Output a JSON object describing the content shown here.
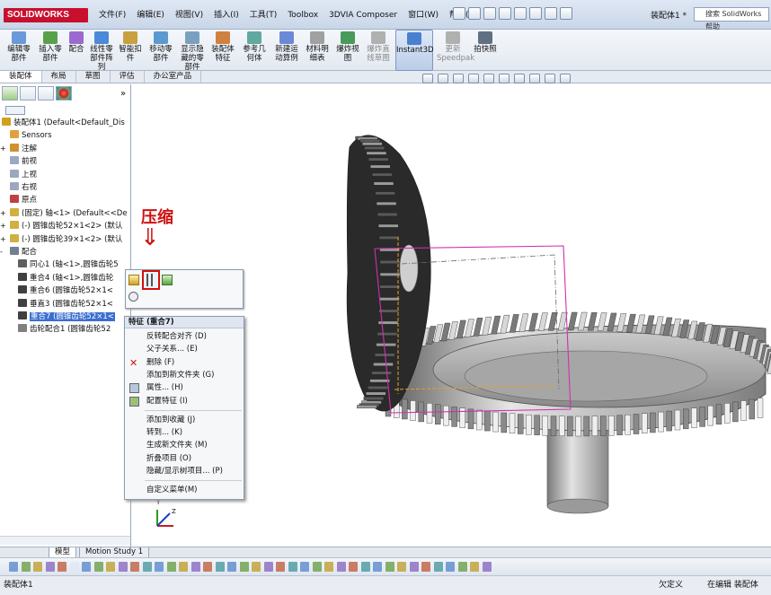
{
  "app": {
    "logo": "SOLIDWORKS",
    "doc_title": "装配体1 *",
    "search_placeholder": "搜索 SolidWorks 帮助"
  },
  "menu": [
    "文件(F)",
    "编辑(E)",
    "视图(V)",
    "插入(I)",
    "工具(T)",
    "Toolbox",
    "3DVIA Composer",
    "窗口(W)",
    "帮助(H)"
  ],
  "ribbon": [
    {
      "label": "编辑零\n部件",
      "icon": "edit-component-icon",
      "enabled": true
    },
    {
      "label": "插入零\n部件",
      "icon": "insert-component-icon",
      "enabled": true
    },
    {
      "label": "配合",
      "icon": "mate-icon",
      "enabled": true
    },
    {
      "label": "线性零\n部件阵\n列",
      "icon": "linear-pattern-icon",
      "enabled": true
    },
    {
      "label": "智能扣\n件",
      "icon": "smart-fastener-icon",
      "enabled": true
    },
    {
      "label": "移动零\n部件",
      "icon": "move-component-icon",
      "enabled": true
    },
    {
      "label": "显示隐\n藏的零\n部件",
      "icon": "show-hidden-icon",
      "enabled": true
    },
    {
      "label": "装配体\n特征",
      "icon": "assembly-feature-icon",
      "enabled": true
    },
    {
      "label": "参考几\n何体",
      "icon": "reference-geometry-icon",
      "enabled": true
    },
    {
      "label": "新建运\n动算例",
      "icon": "new-motion-study-icon",
      "enabled": true
    },
    {
      "label": "材料明\n细表",
      "icon": "bom-icon",
      "enabled": true
    },
    {
      "label": "爆炸视\n图",
      "icon": "exploded-view-icon",
      "enabled": true
    },
    {
      "label": "爆炸直\n线草图",
      "icon": "explode-line-icon",
      "enabled": false
    },
    {
      "label": "Instant3D",
      "icon": "instant3d-icon",
      "enabled": true
    },
    {
      "label": "更新\nSpeedpak",
      "icon": "speedpak-icon",
      "enabled": false
    },
    {
      "label": "拍快照",
      "icon": "snapshot-icon",
      "enabled": true
    }
  ],
  "cmd_tabs": [
    "装配体",
    "布局",
    "草图",
    "评估",
    "办公室产品"
  ],
  "tree": [
    {
      "label": "装配体1  (Default<Default_Dis",
      "icon": "assembly-icon",
      "indent": 0,
      "expander": ""
    },
    {
      "label": "Sensors",
      "icon": "sensors-icon",
      "indent": 1,
      "expander": ""
    },
    {
      "label": "注解",
      "icon": "annotations-icon",
      "indent": 1,
      "expander": "+"
    },
    {
      "label": "前视",
      "icon": "plane-icon",
      "indent": 1,
      "expander": ""
    },
    {
      "label": "上视",
      "icon": "plane-icon",
      "indent": 1,
      "expander": ""
    },
    {
      "label": "右视",
      "icon": "plane-icon",
      "indent": 1,
      "expander": ""
    },
    {
      "label": "原点",
      "icon": "origin-icon",
      "indent": 1,
      "expander": ""
    },
    {
      "label": "(固定) 轴<1> (Default<<De",
      "icon": "part-icon",
      "indent": 1,
      "expander": "+"
    },
    {
      "label": "(-) 圆锥齿轮52×1<2> (默认",
      "icon": "part-icon",
      "indent": 1,
      "expander": "+"
    },
    {
      "label": "(-) 圆锥齿轮39×1<2> (默认",
      "icon": "part-icon",
      "indent": 1,
      "expander": "+"
    },
    {
      "label": "配合",
      "icon": "mates-icon",
      "indent": 1,
      "expander": "-"
    },
    {
      "label": "同心1 (轴<1>,圆锥齿轮5",
      "icon": "concentric-icon",
      "indent": 2,
      "expander": ""
    },
    {
      "label": "重合4 (轴<1>,圆锥齿轮",
      "icon": "coincident-icon",
      "indent": 2,
      "expander": ""
    },
    {
      "label": "重合6 (圆锥齿轮52×1<",
      "icon": "coincident-icon",
      "indent": 2,
      "expander": ""
    },
    {
      "label": "垂直3 (圆锥齿轮52×1<",
      "icon": "perpendicular-icon",
      "indent": 2,
      "expander": ""
    },
    {
      "label": "重合7 (圆锥齿轮52×1<",
      "icon": "coincident-icon",
      "indent": 2,
      "expander": "",
      "selected": true
    },
    {
      "label": "齿轮配合1 (圆锥齿轮52",
      "icon": "gear-mate-icon",
      "indent": 2,
      "expander": ""
    }
  ],
  "annotation": {
    "text": "压缩",
    "arrow": "⇓"
  },
  "context_menu": {
    "header": "特征 (重合7)",
    "groups": [
      [
        {
          "label": "反转配合对齐 (D)",
          "icon": ""
        },
        {
          "label": "父子关系... (E)",
          "icon": ""
        },
        {
          "label": "删除 (F)",
          "icon": "delete-icon"
        },
        {
          "label": "添加到新文件夹 (G)",
          "icon": ""
        },
        {
          "label": "属性... (H)",
          "icon": "properties-icon"
        },
        {
          "label": "配置特征 (I)",
          "icon": "configure-icon"
        }
      ],
      [
        {
          "label": "添加到收藏 (J)",
          "icon": ""
        },
        {
          "label": "转到... (K)",
          "icon": ""
        },
        {
          "label": "生成新文件夹 (M)",
          "icon": ""
        },
        {
          "label": "折叠项目 (O)",
          "icon": ""
        },
        {
          "label": "隐藏/显示树项目... (P)",
          "icon": ""
        }
      ],
      [
        {
          "label": "自定义菜单(M)",
          "icon": ""
        }
      ]
    ]
  },
  "bottom_tabs": [
    "模型",
    "Motion Study 1"
  ],
  "status": {
    "left": "装配体1",
    "right1": "欠定义",
    "right2": "在编辑 装配体"
  },
  "triad": {
    "x": "X",
    "y": "Y",
    "z": "Z"
  },
  "colors": {
    "accent": "#3a6fd0",
    "annotation": "#d01010",
    "brand": "#c8102e",
    "sketch": "#d12fb0"
  }
}
